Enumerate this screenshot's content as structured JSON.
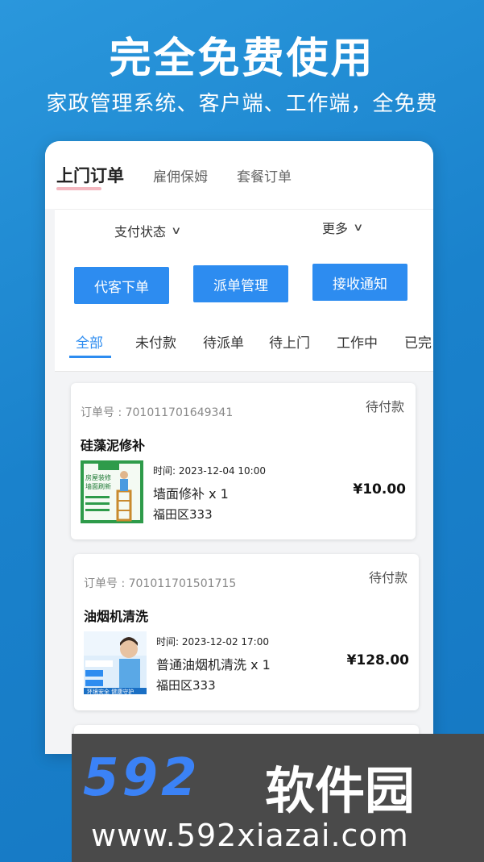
{
  "promo": {
    "title": "完全免费使用",
    "subtitle": "家政管理系统、客户端、工作端，全免费"
  },
  "top_tabs": [
    {
      "label": "上门订单",
      "active": true
    },
    {
      "label": "雇佣保姆",
      "active": false
    },
    {
      "label": "套餐订单",
      "active": false
    }
  ],
  "filters": {
    "pay_status": "支付状态",
    "more": "更多"
  },
  "actions": {
    "place_order": "代客下单",
    "dispatch": "派单管理",
    "notify": "接收通知"
  },
  "status_tabs": [
    "全部",
    "未付款",
    "待派单",
    "待上门",
    "工作中",
    "已完"
  ],
  "orders": [
    {
      "order_no": "订单号 : 701011701649341",
      "status": "待付款",
      "title": "硅藻泥修补",
      "time": "时间:  2023-12-04 10:00",
      "item": "墙面修补 x 1",
      "address": "福田区333",
      "price": "¥10.00",
      "image_text": [
        "房屋装修",
        "墙面刷新"
      ]
    },
    {
      "order_no": "订单号 : 701011701501715",
      "status": "待付款",
      "title": "油烟机清洗",
      "time": "时间:  2023-12-02 17:00",
      "item": "普通油烟机清洗 x 1",
      "address": "福田区333",
      "price": "¥128.00",
      "image_text": [
        "环境安全 健康守护"
      ]
    }
  ],
  "watermark": {
    "logo": "592",
    "brand": "软件园",
    "url": "www.592xiazai.com"
  },
  "colors": {
    "background": "#1c86cf",
    "accent": "#2d8cf0"
  }
}
